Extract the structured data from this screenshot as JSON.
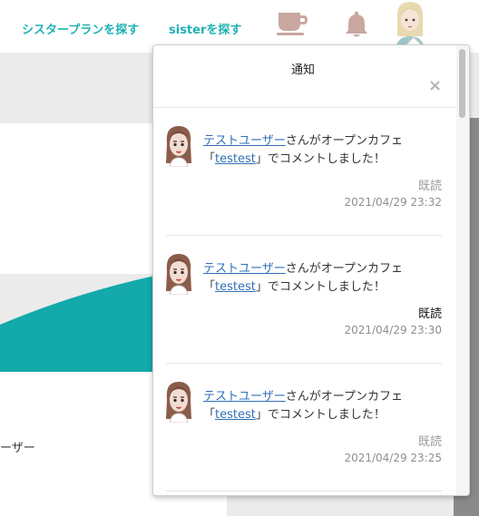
{
  "nav": {
    "find_plan": "シスタープランを探す",
    "find_sister": "sisterを探す"
  },
  "background": {
    "partial_text": "ーザー"
  },
  "panel": {
    "title": "通知",
    "close": "×"
  },
  "notifications": [
    {
      "user": "テストユーザー",
      "text1": "さんがオープンカフェ",
      "quote_open": "「",
      "cafe": "testest",
      "text2": "」でコメントしました！",
      "status": "既読",
      "status_color": "#9a9a9a",
      "time": "2021/04/29 23:32"
    },
    {
      "user": "テストユーザー",
      "text1": "さんがオープンカフェ",
      "quote_open": "「",
      "cafe": "testest",
      "text2": "」でコメントしました！",
      "status": "既読",
      "status_color": "#111111",
      "time": "2021/04/29 23:30"
    },
    {
      "user": "テストユーザー",
      "text1": "さんがオープンカフェ",
      "quote_open": "「",
      "cafe": "testest",
      "text2": "」でコメントしました！",
      "status": "既読",
      "status_color": "#9a9a9a",
      "time": "2021/04/29 23:25"
    }
  ],
  "colors": {
    "accent": "#1fb1b5",
    "icon": "#c9a79f",
    "link": "#2f6fb8"
  },
  "icons": {
    "cafe": "coffee-cup-icon",
    "bell": "bell-icon",
    "avatar": "user-avatar"
  }
}
